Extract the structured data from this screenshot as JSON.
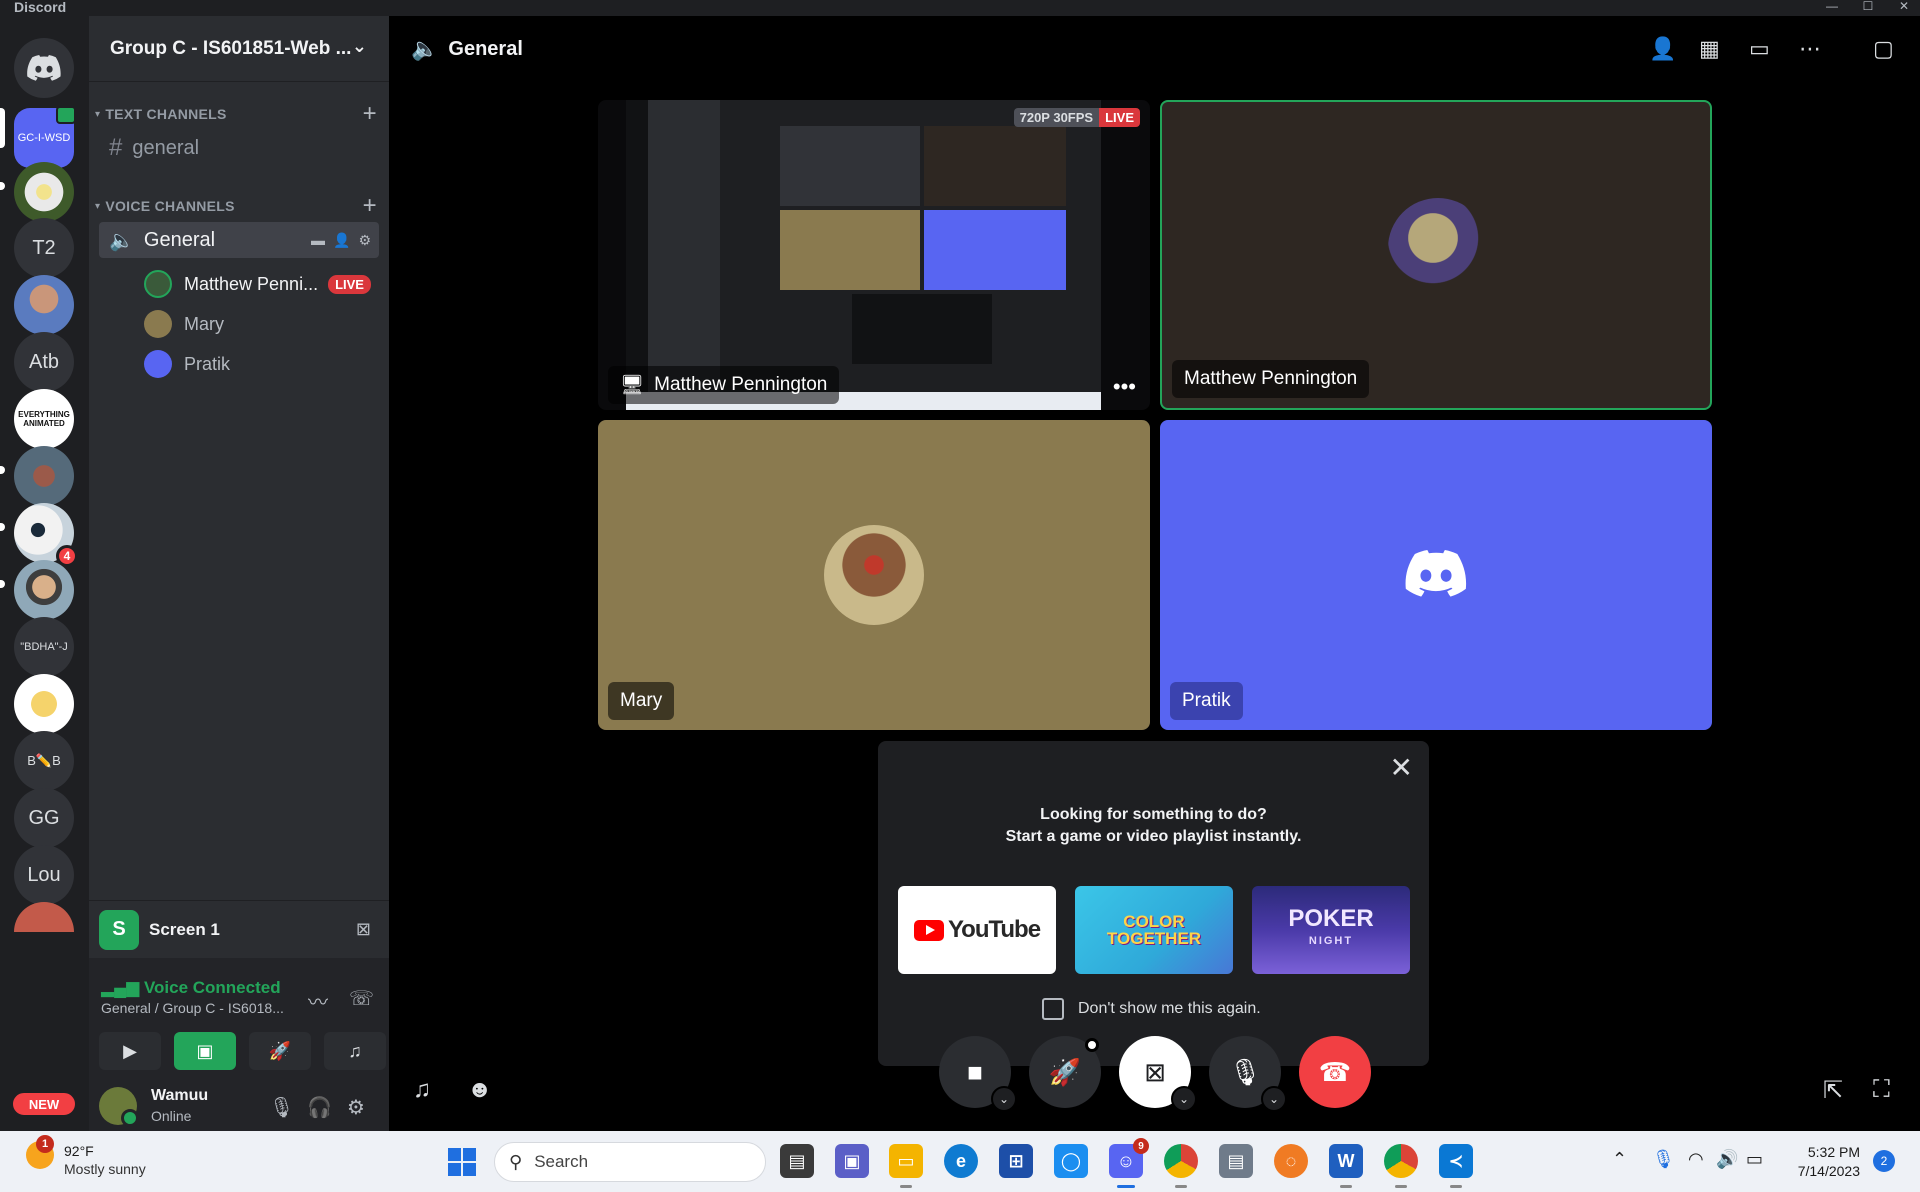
{
  "window": {
    "app_name": "Discord",
    "min": "—",
    "max": "☐",
    "close": "✕"
  },
  "servers": [
    {
      "label": "GC-I-WSD"
    },
    {
      "label": "T2"
    },
    {
      "label": "Atb"
    },
    {
      "label": "EVERYTHING ANIMATED"
    },
    {
      "label": "\"BDHA\"-J"
    },
    {
      "label": "B✏️B"
    },
    {
      "label": "GG"
    },
    {
      "label": "Lou"
    }
  ],
  "server_badge": "4",
  "new_badge": "NEW",
  "sidebar": {
    "server_name": "Group C - IS601851-Web ...",
    "text_category": "TEXT CHANNELS",
    "text_channel": "general",
    "voice_category": "VOICE CHANNELS",
    "voice_channel": "General",
    "members": [
      {
        "name": "Matthew Penni...",
        "live": "LIVE"
      },
      {
        "name": "Mary"
      },
      {
        "name": "Pratik"
      }
    ],
    "screen_label": "Screen 1",
    "screen_initial": "S",
    "voice_status": "Voice Connected",
    "voice_location": "General / Group C - IS6018...",
    "user_name": "Wamuu",
    "user_status": "Online"
  },
  "main": {
    "channel_title": "General",
    "stream": {
      "quality": "720P 30FPS",
      "live": "LIVE",
      "name": "Matthew Pennington"
    },
    "tiles": {
      "matthew": "Matthew Pennington",
      "mary": "Mary",
      "pratik": "Pratik"
    },
    "activity": {
      "line1": "Looking for something to do?",
      "line2": "Start a game or video playlist instantly.",
      "youtube": "YouTube",
      "color_together": "COLOR TOGETHER",
      "poker": "POKER",
      "poker_sub": "NIGHT",
      "checkbox_label": "Don't show me this again."
    }
  },
  "taskbar": {
    "weather_badge": "1",
    "temperature": "92°F",
    "condition": "Mostly sunny",
    "search_placeholder": "Search",
    "discord_badge": "9",
    "time": "5:32 PM",
    "date": "7/14/2023",
    "notifications": "2"
  },
  "colors": {
    "accent": "#5865f2",
    "green": "#23a55a",
    "red": "#f23f43"
  }
}
